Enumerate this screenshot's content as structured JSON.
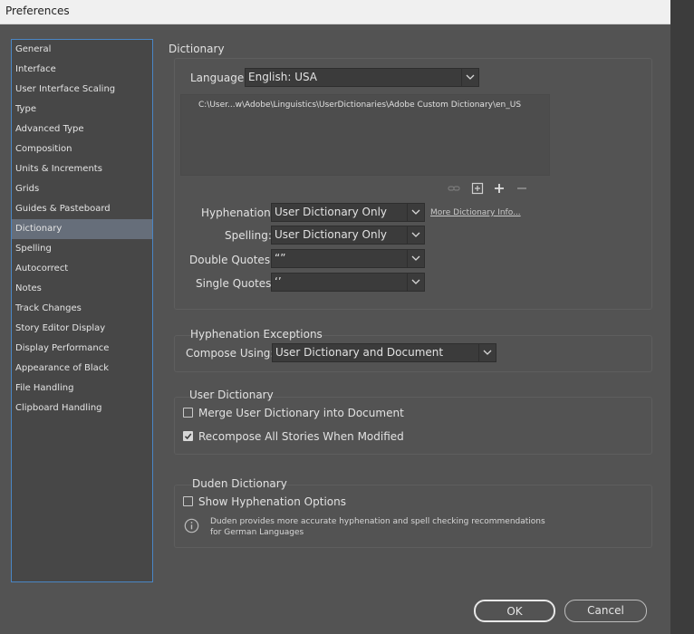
{
  "window": {
    "title": "Preferences"
  },
  "sidebar": {
    "items": [
      {
        "label": "General"
      },
      {
        "label": "Interface"
      },
      {
        "label": "User Interface Scaling"
      },
      {
        "label": "Type"
      },
      {
        "label": "Advanced Type"
      },
      {
        "label": "Composition"
      },
      {
        "label": "Units & Increments"
      },
      {
        "label": "Grids"
      },
      {
        "label": "Guides & Pasteboard"
      },
      {
        "label": "Dictionary"
      },
      {
        "label": "Spelling"
      },
      {
        "label": "Autocorrect"
      },
      {
        "label": "Notes"
      },
      {
        "label": "Track Changes"
      },
      {
        "label": "Story Editor Display"
      },
      {
        "label": "Display Performance"
      },
      {
        "label": "Appearance of Black"
      },
      {
        "label": "File Handling"
      },
      {
        "label": "Clipboard Handling"
      }
    ],
    "selected": "Dictionary"
  },
  "dictionary": {
    "heading": "Dictionary",
    "language_label": "Language:",
    "language_value": "English: USA",
    "path": "C:\\User...w\\Adobe\\Linguistics\\UserDictionaries\\Adobe Custom Dictionary\\en_US",
    "hyphenation_label": "Hyphenation:",
    "hyphenation_value": "User Dictionary Only",
    "spelling_label": "Spelling:",
    "spelling_value": "User Dictionary Only",
    "double_quotes_label": "Double Quotes:",
    "double_quotes_value": "“”",
    "single_quotes_label": "Single Quotes:",
    "single_quotes_value": "‘’",
    "more_info_link": "More Dictionary Info..."
  },
  "hyphenation_exceptions": {
    "heading": "Hyphenation Exceptions",
    "compose_label": "Compose Using:",
    "compose_value": "User Dictionary and Document"
  },
  "user_dictionary": {
    "heading": "User Dictionary",
    "merge_label": "Merge User Dictionary into Document",
    "merge_checked": false,
    "recompose_label": "Recompose All Stories When Modified",
    "recompose_checked": true
  },
  "duden": {
    "heading": "Duden Dictionary",
    "show_label": "Show Hyphenation Options",
    "show_checked": false,
    "info_line1": "Duden provides more accurate hyphenation and spell checking recommendations",
    "info_line2": "for German Languages"
  },
  "buttons": {
    "ok": "OK",
    "cancel": "Cancel"
  }
}
